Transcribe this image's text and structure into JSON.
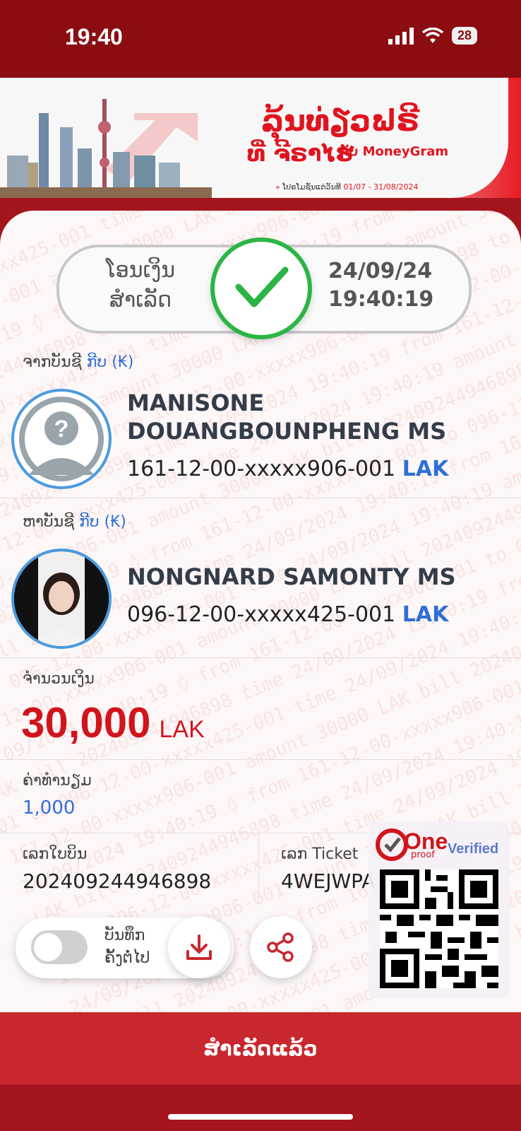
{
  "status_bar": {
    "time": "19:40",
    "battery": "28"
  },
  "banner": {
    "title": "ລຸ້ນທ່ຽວຟຣີ",
    "subtitle": "ທີ່ ຈີຣາໄຮ",
    "with_brand": "ກັບ MoneyGram",
    "promo_text": "ໂປຣໂມຊັ່ນແຕ່ວັນທີ",
    "promo_dates": "01/07 - 31/08/2024"
  },
  "status": {
    "line1": "ໂອນເງິນ",
    "line2": "ສຳເລັດ",
    "date": "24/09/24",
    "time": "19:40:19"
  },
  "from": {
    "label": "ຈາກບັນຊີ",
    "currency_label": "ກີບ (₭)",
    "name_line1": "MANISONE",
    "name_line2": "DOUANGBOUNPHENG MS",
    "account": "161-12-00-xxxxx906-001",
    "currency": "LAK"
  },
  "to": {
    "label": "ຫາບັນຊີ",
    "currency_label": "ກີບ (₭)",
    "name": "NONGNARD SAMONTY MS",
    "account": "096-12-00-xxxxx425-001",
    "currency": "LAK"
  },
  "amount": {
    "label": "ຈຳນວນເງິນ",
    "value": "30,000",
    "currency": "LAK"
  },
  "fee": {
    "label": "ຄ່າທໍານຽມ",
    "value": "1,000"
  },
  "bill": {
    "label": "ເລກໃບບິນ",
    "value": "202409244946898"
  },
  "ticket": {
    "label": "ເລກ Ticket",
    "value": "4WEJWPA"
  },
  "actions": {
    "save_label_line1": "ບັນທຶກ",
    "save_label_line2": "ຄັ້ງຕໍ່ໄປ",
    "save_toggle_on": false
  },
  "verified": {
    "one": "One",
    "proof": "proof",
    "verified_text": "Verified"
  },
  "bottom_button": "ສຳເລັດແລ້ວ",
  "colors": {
    "brand_red": "#c8272d",
    "accent_blue": "#2f6fd6",
    "success_green": "#2bb544"
  }
}
